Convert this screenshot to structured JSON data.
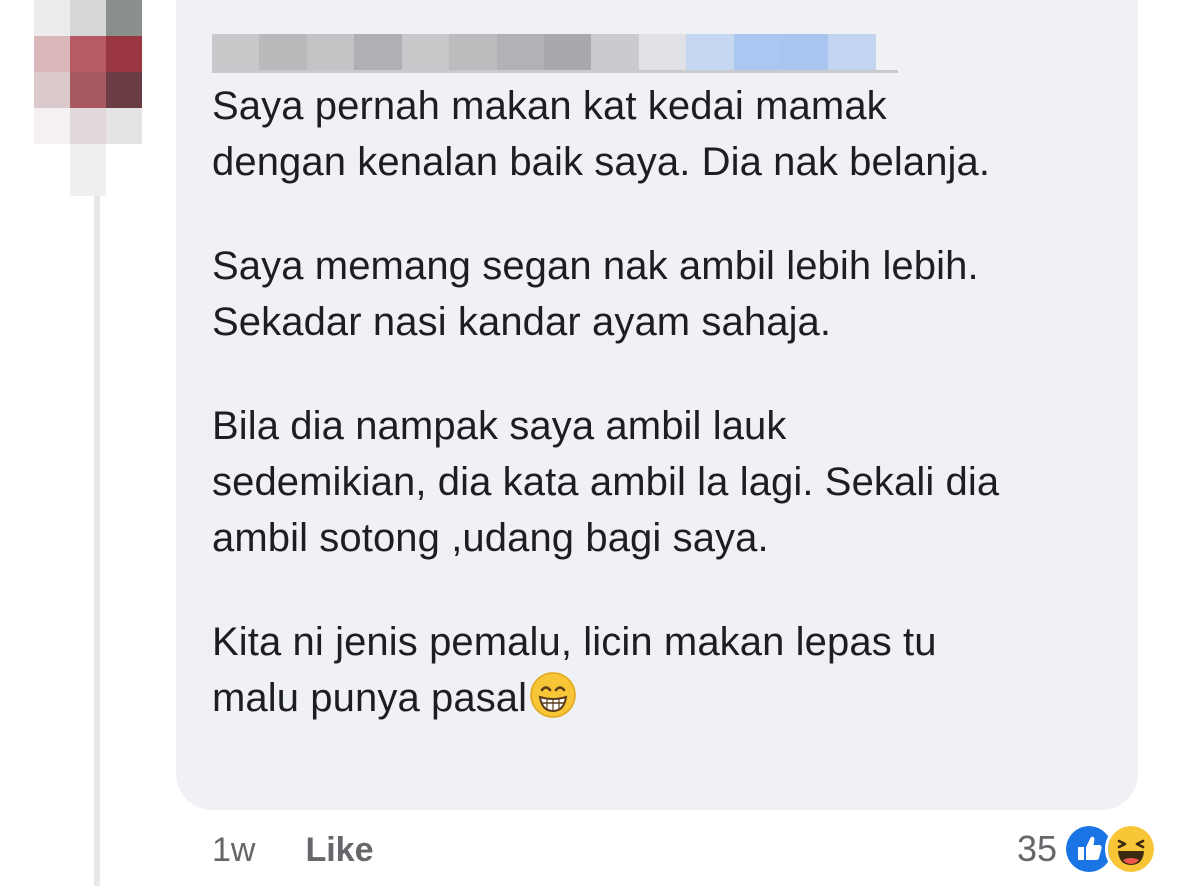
{
  "comment": {
    "paragraphs": [
      {
        "lines": [
          "Saya pernah makan kat kedai mamak",
          "dengan kenalan baik saya. Dia nak belanja."
        ]
      },
      {
        "lines": [
          "Saya memang segan nak ambil lebih lebih.",
          "Sekadar nasi kandar ayam sahaja."
        ]
      },
      {
        "lines": [
          "Bila dia nampak saya ambil lauk",
          "sedemikian, dia kata ambil la lagi. Sekali dia",
          "ambil sotong ,udang bagi saya."
        ]
      },
      {
        "lines": [
          "Kita ni jenis pemalu, licin makan lepas tu",
          "malu punya pasal"
        ]
      }
    ],
    "trailing_emoji": "grinning-face-with-smiling-eyes"
  },
  "footer": {
    "time": "1w",
    "like_label": "Like"
  },
  "reactions": {
    "count": "35",
    "icons": [
      "like-icon",
      "haha-icon"
    ]
  },
  "colors": {
    "bubble": "#f0f1f4",
    "text": "#1c1e21",
    "meta": "#65676b",
    "like_blue": "#1b74e4",
    "haha_yellow": "#f7c536"
  }
}
